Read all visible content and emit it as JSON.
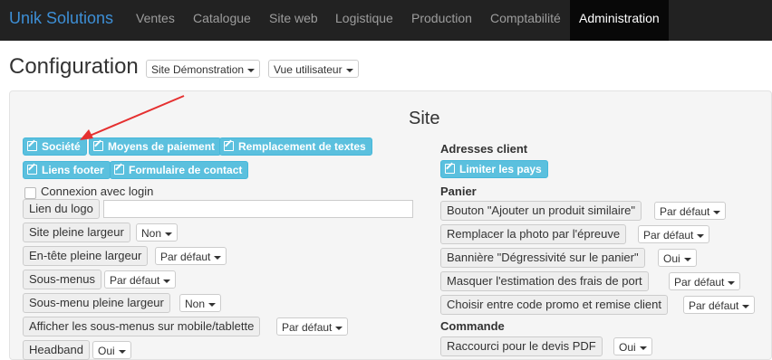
{
  "topbar": {
    "brand": "Unik Solutions",
    "menu": [
      "Ventes",
      "Catalogue",
      "Site web",
      "Logistique",
      "Production",
      "Comptabilité",
      "Administration"
    ]
  },
  "page": {
    "title": "Configuration",
    "site_select": "Site Démonstration",
    "view_select": "Vue utilisateur"
  },
  "section": {
    "title": "Site"
  },
  "left": {
    "buttons": [
      "Société",
      "Moyens de paiement",
      "Remplacement de textes",
      "Liens footer",
      "Formulaire de contact"
    ],
    "checkbox_label": "Connexion avec login",
    "logo_link_label": "Lien du logo",
    "settings": [
      {
        "label": "Site pleine largeur",
        "value": "Non"
      },
      {
        "label": "En-tête pleine largeur",
        "value": "Par défaut"
      },
      {
        "label": "Sous-menus",
        "value": "Par défaut"
      },
      {
        "label": "Sous-menu pleine largeur",
        "value": "Non"
      },
      {
        "label": "Afficher les sous-menus sur mobile/tablette",
        "value": "Par défaut"
      },
      {
        "label": "Headband",
        "value": "Oui"
      }
    ]
  },
  "right": {
    "addresses_heading": "Adresses client",
    "limit_button": "Limiter les pays",
    "cart_heading": "Panier",
    "cart_settings": [
      {
        "label": "Bouton \"Ajouter un produit similaire\"",
        "value": "Par défaut"
      },
      {
        "label": "Remplacer la photo par l'épreuve",
        "value": "Par défaut"
      },
      {
        "label": "Bannière \"Dégressivité sur le panier\"",
        "value": "Oui"
      },
      {
        "label": "Masquer l'estimation des frais de port",
        "value": "Par défaut"
      },
      {
        "label": "Choisir entre code promo et remise client",
        "value": "Par défaut"
      }
    ],
    "order_heading": "Commande",
    "order_settings": [
      {
        "label": "Raccourci pour le devis PDF",
        "value": "Oui"
      }
    ]
  }
}
